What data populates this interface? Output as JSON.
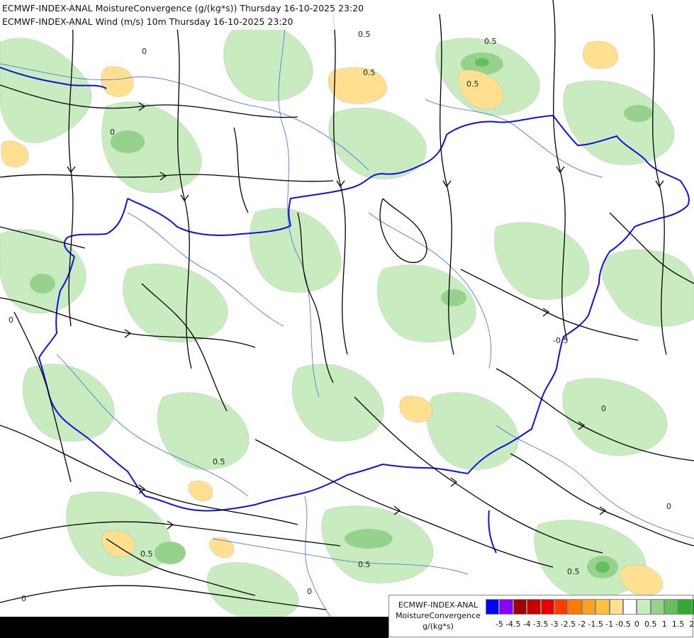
{
  "titles": {
    "line1": "ECMWF-INDEX-ANAL MoistureConvergence (g/(kg*s)) Thursday 16-10-2025 23:20",
    "line2": "ECMWF-INDEX-ANAL Wind (m/s) 10m Thursday 16-10-2025 23:20"
  },
  "legend": {
    "line1": "ECMWF-INDEX-ANAL",
    "line2": "MoistureConvergence",
    "line3": "g/(kg*s)",
    "colors": [
      "#0000ff",
      "#8a00ff",
      "#a00000",
      "#c80000",
      "#e60000",
      "#ff3c00",
      "#ff7a00",
      "#ffa020",
      "#ffc040",
      "#ffe090",
      "#ffffff",
      "#c8ecc0",
      "#96d28c",
      "#64c05a",
      "#32aa32",
      "#00a000"
    ],
    "tick_labels": [
      "-5",
      "-4.5",
      "-4",
      "-3.5",
      "-3",
      "-2.5",
      "-2",
      "-1.5",
      "-1",
      "-0.5",
      "0",
      "0.5",
      "1",
      "1.5",
      "2"
    ]
  },
  "contour_labels": [
    "0",
    "0.5",
    "-0.5"
  ]
}
